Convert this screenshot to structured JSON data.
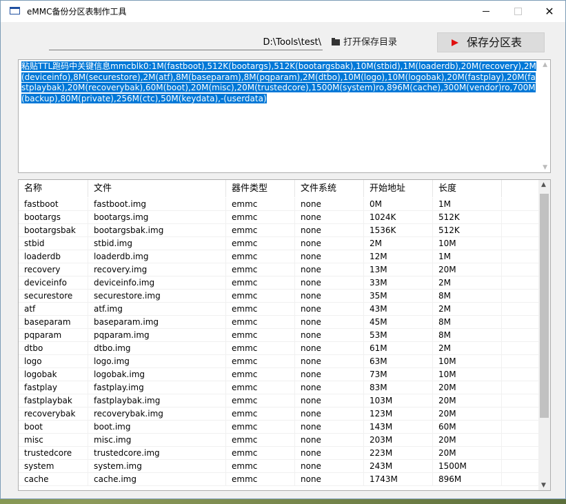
{
  "window": {
    "title": "eMMC备份分区表制作工具",
    "controls": {
      "minimize": "—",
      "maximize": "□",
      "close": "✕"
    }
  },
  "toolbar": {
    "path_value": "D:\\Tools\\test\\",
    "open_dir_label": "打开保存目录",
    "save_label": "保存分区表",
    "icons": {
      "open_dir": "folder-open-icon",
      "save": "play-icon"
    },
    "save_icon_color": "#e01010"
  },
  "input": {
    "text": "粘贴TTL跑码中关键信息mmcblk0:1M(fastboot),512K(bootargs),512K(bootargsbak),10M(stbid),1M(loaderdb),20M(recovery),2M(deviceinfo),8M(securestore),2M(atf),8M(baseparam),8M(pqparam),2M(dtbo),10M(logo),10M(logobak),20M(fastplay),20M(fastplaybak),20M(recoverybak),60M(boot),20M(misc),20M(trustedcore),1500M(system)ro,896M(cache),300M(vendor)ro,700M(backup),80M(private),256M(ctc),50M(keydata),-(userdata)",
    "selection_color": "#0078d7"
  },
  "table": {
    "columns": [
      "名称",
      "文件",
      "器件类型",
      "文件系统",
      "开始地址",
      "长度"
    ],
    "rows": [
      [
        "fastboot",
        "fastboot.img",
        "emmc",
        "none",
        "0M",
        "1M"
      ],
      [
        "bootargs",
        "bootargs.img",
        "emmc",
        "none",
        "1024K",
        "512K"
      ],
      [
        "bootargsbak",
        "bootargsbak.img",
        "emmc",
        "none",
        "1536K",
        "512K"
      ],
      [
        "stbid",
        "stbid.img",
        "emmc",
        "none",
        "2M",
        "10M"
      ],
      [
        "loaderdb",
        "loaderdb.img",
        "emmc",
        "none",
        "12M",
        "1M"
      ],
      [
        "recovery",
        "recovery.img",
        "emmc",
        "none",
        "13M",
        "20M"
      ],
      [
        "deviceinfo",
        "deviceinfo.img",
        "emmc",
        "none",
        "33M",
        "2M"
      ],
      [
        "securestore",
        "securestore.img",
        "emmc",
        "none",
        "35M",
        "8M"
      ],
      [
        "atf",
        "atf.img",
        "emmc",
        "none",
        "43M",
        "2M"
      ],
      [
        "baseparam",
        "baseparam.img",
        "emmc",
        "none",
        "45M",
        "8M"
      ],
      [
        "pqparam",
        "pqparam.img",
        "emmc",
        "none",
        "53M",
        "8M"
      ],
      [
        "dtbo",
        "dtbo.img",
        "emmc",
        "none",
        "61M",
        "2M"
      ],
      [
        "logo",
        "logo.img",
        "emmc",
        "none",
        "63M",
        "10M"
      ],
      [
        "logobak",
        "logobak.img",
        "emmc",
        "none",
        "73M",
        "10M"
      ],
      [
        "fastplay",
        "fastplay.img",
        "emmc",
        "none",
        "83M",
        "20M"
      ],
      [
        "fastplaybak",
        "fastplaybak.img",
        "emmc",
        "none",
        "103M",
        "20M"
      ],
      [
        "recoverybak",
        "recoverybak.img",
        "emmc",
        "none",
        "123M",
        "20M"
      ],
      [
        "boot",
        "boot.img",
        "emmc",
        "none",
        "143M",
        "60M"
      ],
      [
        "misc",
        "misc.img",
        "emmc",
        "none",
        "203M",
        "20M"
      ],
      [
        "trustedcore",
        "trustedcore.img",
        "emmc",
        "none",
        "223M",
        "20M"
      ],
      [
        "system",
        "system.img",
        "emmc",
        "none",
        "243M",
        "1500M"
      ],
      [
        "cache",
        "cache.img",
        "emmc",
        "none",
        "1743M",
        "896M"
      ]
    ]
  }
}
